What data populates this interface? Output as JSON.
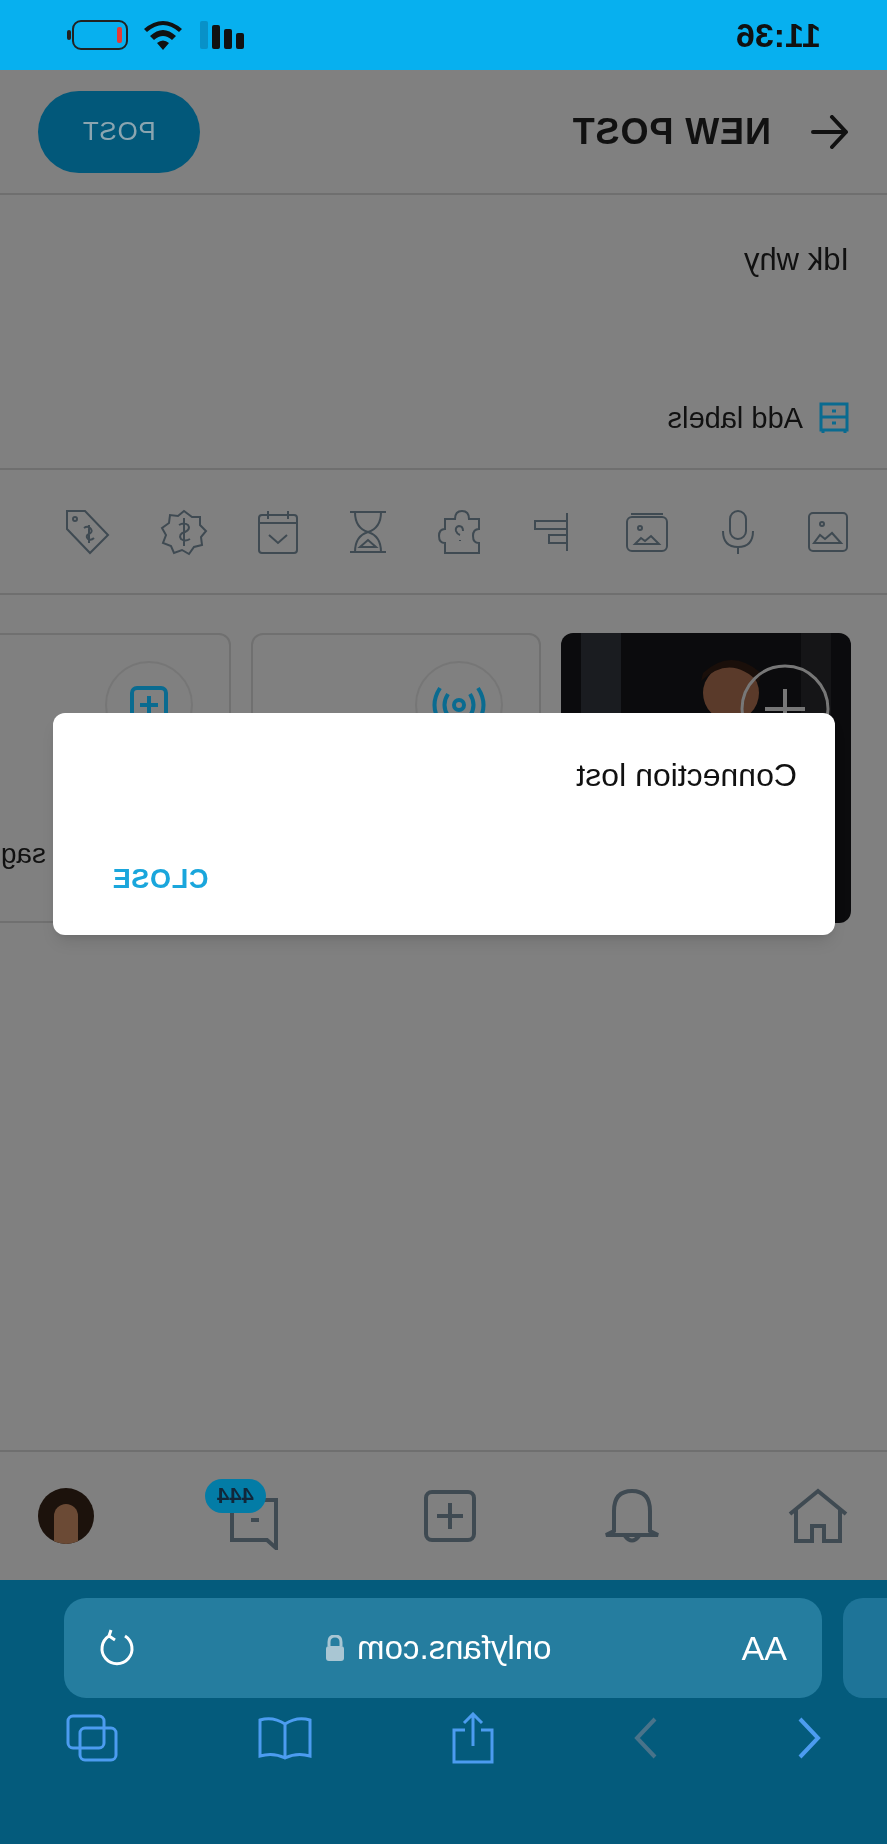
{
  "status_bar": {
    "time": "11:36"
  },
  "header": {
    "title": "NEW POST",
    "post_button": "POST"
  },
  "post": {
    "text": "Idk why",
    "add_labels": "Add labels"
  },
  "cards": [
    {
      "kind": "picture"
    },
    {
      "kind": "stream"
    },
    {
      "kind": "message",
      "label": "sag"
    }
  ],
  "dialog": {
    "message": "Connection lost",
    "button": "CLOSE"
  },
  "bottom_nav": {
    "badge": "444"
  },
  "browser": {
    "text_size": "AA",
    "url": "onlyfans.com"
  }
}
